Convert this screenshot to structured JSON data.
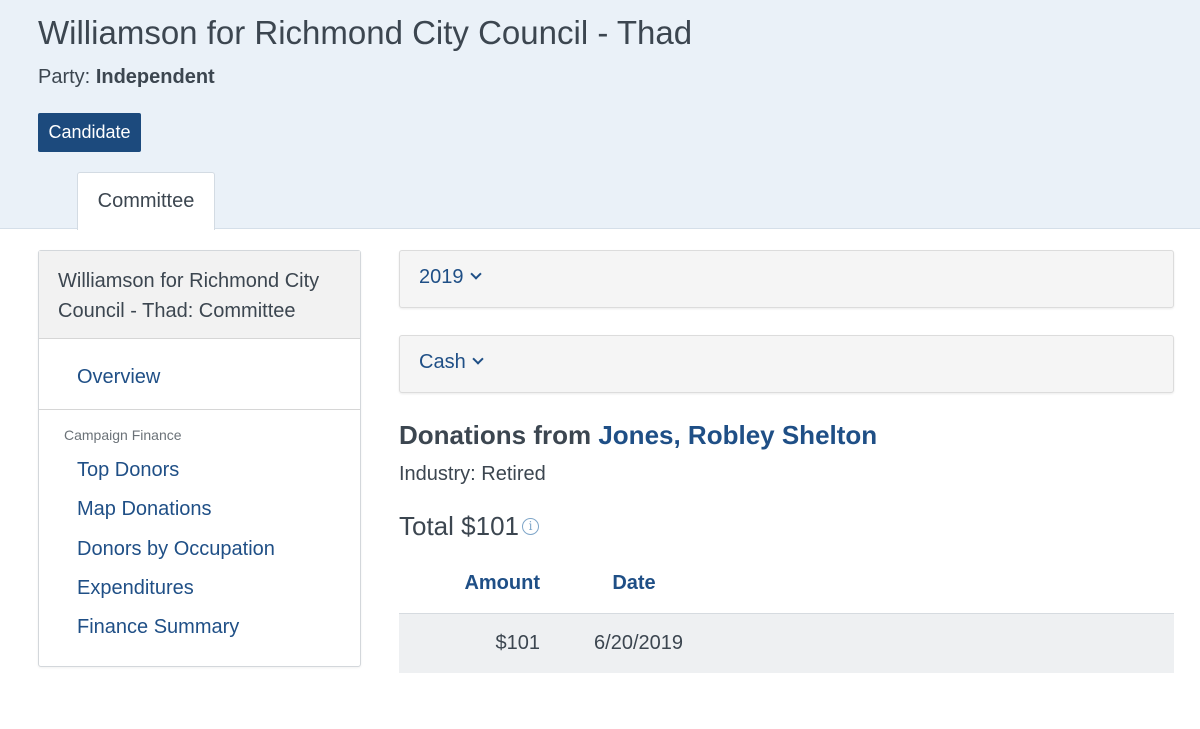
{
  "header": {
    "title": "Williamson for Richmond City Council - Thad",
    "party_label": "Party:",
    "party_value": "Independent",
    "candidate_button": "Candidate",
    "tab_committee": "Committee"
  },
  "sidebar": {
    "heading": "Williamson for Richmond City Council - Thad: Committee",
    "overview": "Overview",
    "section_label": "Campaign Finance",
    "items": [
      {
        "label": "Top Donors"
      },
      {
        "label": "Map Donations"
      },
      {
        "label": "Donors by Occupation"
      },
      {
        "label": "Expenditures"
      },
      {
        "label": "Finance Summary"
      }
    ]
  },
  "filters": {
    "year": "2019",
    "type": "Cash"
  },
  "donor": {
    "heading_prefix": "Donations from",
    "name": "Jones, Robley Shelton",
    "industry": "Industry: Retired",
    "total": "Total $101",
    "info_icon": "i"
  },
  "table": {
    "columns": [
      "Amount",
      "Date"
    ],
    "rows": [
      {
        "amount": "$101",
        "date": "6/20/2019"
      }
    ]
  },
  "colors": {
    "accent": "#1c4a7d",
    "link": "#1f4f86",
    "header_bg": "#eaf1f8"
  }
}
